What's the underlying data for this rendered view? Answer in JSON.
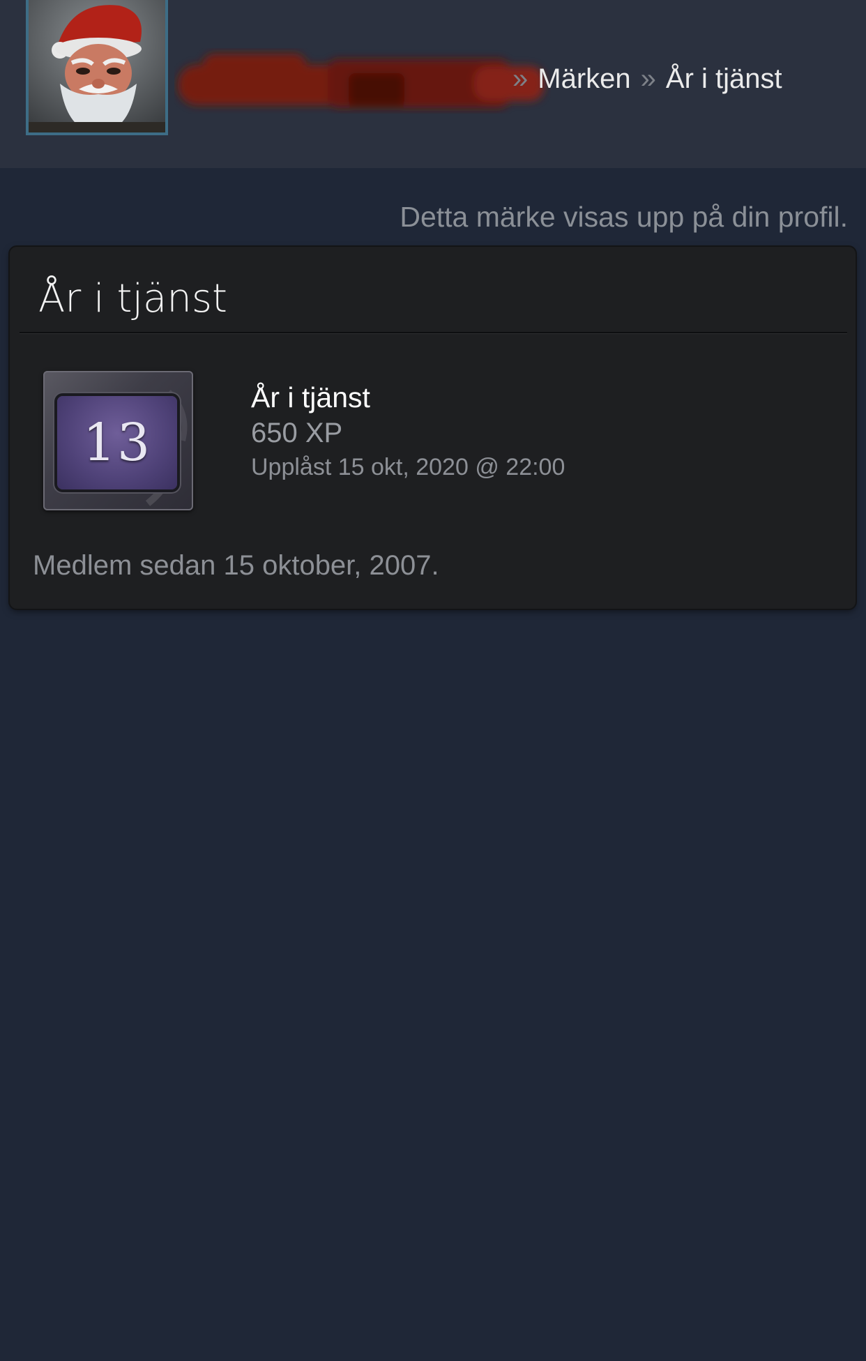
{
  "header": {
    "breadcrumb": {
      "separator": "»",
      "badges_label": "Märken",
      "current_label": "År i tjänst"
    }
  },
  "notice": "Detta märke visas upp på din profil.",
  "panel": {
    "title": "År i tjänst",
    "badge": {
      "number": "13",
      "name": "År i tjänst",
      "xp": "650 XP",
      "unlocked": "Upplåst 15 okt, 2020 @ 22:00"
    },
    "member_since": "Medlem sedan 15 oktober, 2007."
  },
  "colors": {
    "page_background": "#1f2737",
    "header_background": "#2b313f",
    "panel_background": "#1e1f21",
    "avatar_border": "#3d6d86",
    "redaction": "#7a1a10",
    "badge_face": "#4f4278"
  }
}
